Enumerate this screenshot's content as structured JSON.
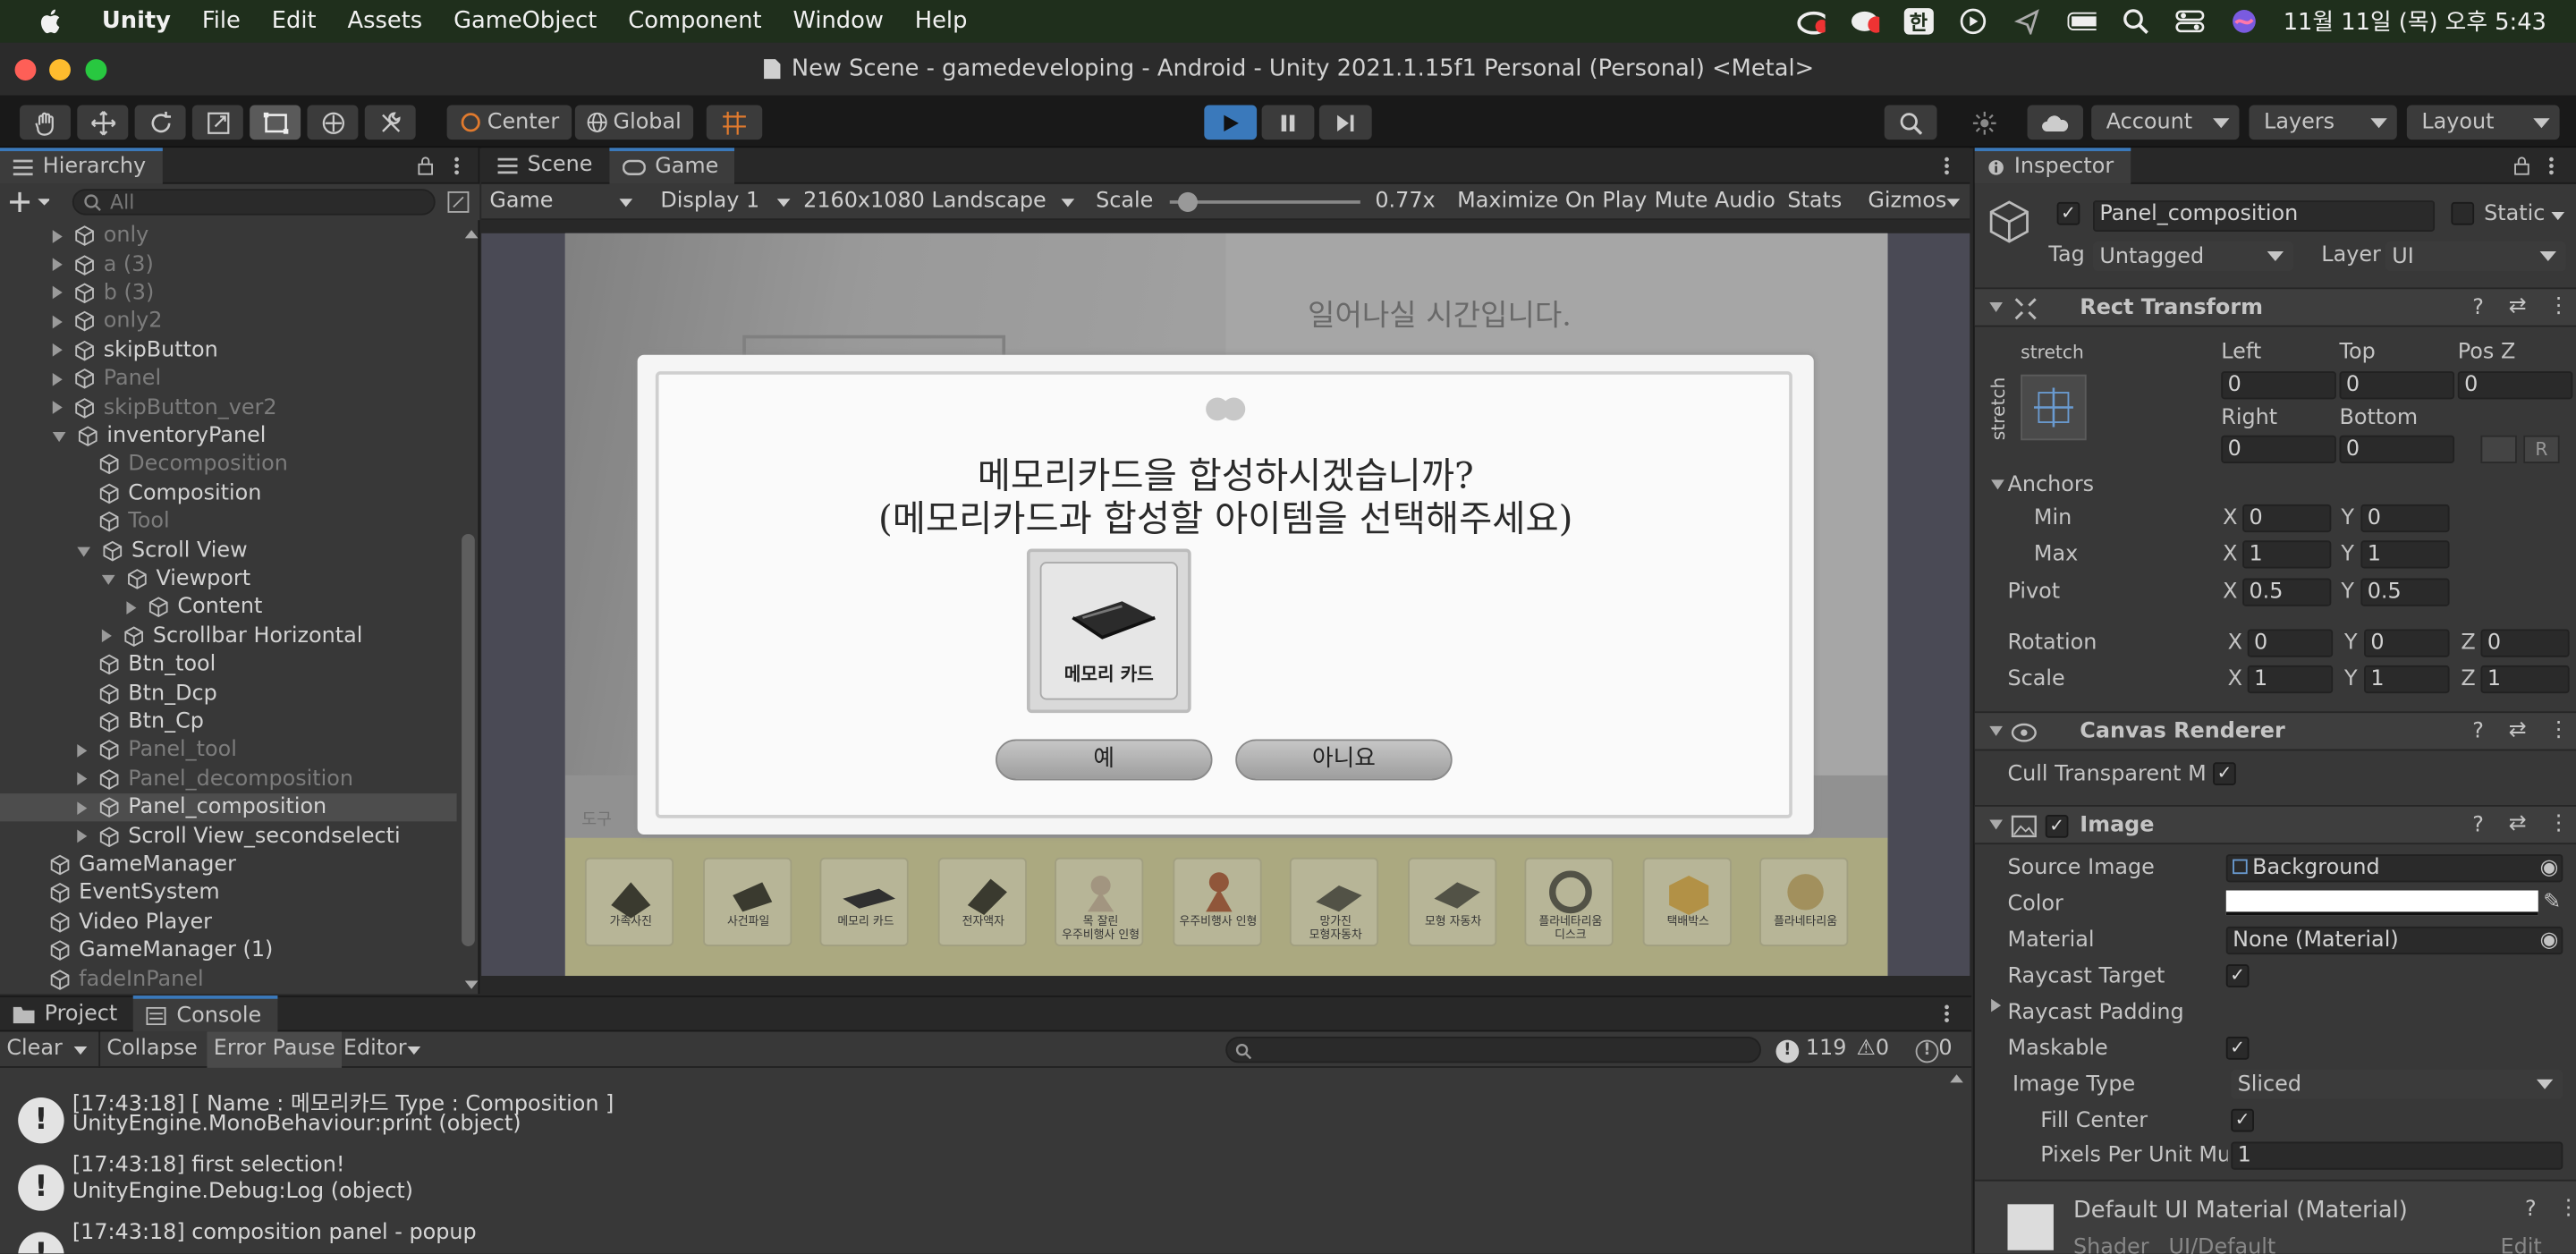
{
  "menubar": {
    "app": "Unity",
    "items": [
      "File",
      "Edit",
      "Assets",
      "GameObject",
      "Component",
      "Window",
      "Help"
    ],
    "clock": "11월 11일 (목) 오후 5:43",
    "ime": "한"
  },
  "window": {
    "title": "New Scene - gamedeveloping - Android - Unity 2021.1.15f1 Personal (Personal) <Metal>"
  },
  "toolbar": {
    "pivot": "Center",
    "space": "Global",
    "account": "Account",
    "layers": "Layers",
    "layout": "Layout"
  },
  "hierarchy": {
    "tab": "Hierarchy",
    "search_placeholder": "All",
    "rows": [
      {
        "label": "only",
        "depth": 2,
        "arrow": "r",
        "dim": true
      },
      {
        "label": "a (3)",
        "depth": 2,
        "arrow": "r",
        "dim": true
      },
      {
        "label": "b (3)",
        "depth": 2,
        "arrow": "r",
        "dim": true
      },
      {
        "label": "only2",
        "depth": 2,
        "arrow": "r",
        "dim": true
      },
      {
        "label": "skipButton",
        "depth": 2,
        "arrow": "r",
        "dim": false
      },
      {
        "label": "Panel",
        "depth": 2,
        "arrow": "r",
        "dim": true
      },
      {
        "label": "skipButton_ver2",
        "depth": 2,
        "arrow": "r",
        "dim": true
      },
      {
        "label": "inventoryPanel",
        "depth": 2,
        "arrow": "d",
        "dim": false
      },
      {
        "label": "Decomposition",
        "depth": 3,
        "arrow": "",
        "dim": true
      },
      {
        "label": "Composition",
        "depth": 3,
        "arrow": "",
        "dim": false
      },
      {
        "label": "Tool",
        "depth": 3,
        "arrow": "",
        "dim": true
      },
      {
        "label": "Scroll View",
        "depth": 3,
        "arrow": "d",
        "dim": false
      },
      {
        "label": "Viewport",
        "depth": 4,
        "arrow": "d",
        "dim": false
      },
      {
        "label": "Content",
        "depth": 5,
        "arrow": "r",
        "dim": false
      },
      {
        "label": "Scrollbar Horizontal",
        "depth": 4,
        "arrow": "r",
        "dim": false
      },
      {
        "label": "Btn_tool",
        "depth": 3,
        "arrow": "",
        "dim": false
      },
      {
        "label": "Btn_Dcp",
        "depth": 3,
        "arrow": "",
        "dim": false
      },
      {
        "label": "Btn_Cp",
        "depth": 3,
        "arrow": "",
        "dim": false
      },
      {
        "label": "Panel_tool",
        "depth": 3,
        "arrow": "r",
        "dim": true
      },
      {
        "label": "Panel_decomposition",
        "depth": 3,
        "arrow": "r",
        "dim": true
      },
      {
        "label": "Panel_composition",
        "depth": 3,
        "arrow": "r",
        "dim": false,
        "selected": true
      },
      {
        "label": "Scroll View_secondselecti",
        "depth": 3,
        "arrow": "r",
        "dim": false
      },
      {
        "label": "GameManager",
        "depth": 1,
        "arrow": "",
        "dim": false
      },
      {
        "label": "EventSystem",
        "depth": 1,
        "arrow": "",
        "dim": false
      },
      {
        "label": "Video Player",
        "depth": 1,
        "arrow": "",
        "dim": false
      },
      {
        "label": "GameManager (1)",
        "depth": 1,
        "arrow": "",
        "dim": false
      },
      {
        "label": "fadeInPanel",
        "depth": 1,
        "arrow": "",
        "dim": true
      }
    ]
  },
  "game": {
    "tabs": {
      "scene": "Scene",
      "game": "Game"
    },
    "display_mode": "Game",
    "display": "Display 1",
    "resolution": "2160x1080 Landscape",
    "scale_label": "Scale",
    "scale_value": "0.77x",
    "scale_fraction": 0.04,
    "maximize": "Maximize On Play",
    "mute": "Mute Audio",
    "stats": "Stats",
    "gizmos": "Gizmos",
    "screen": {
      "bg_text": "일어나실 시간입니다.",
      "tool_label": "도구",
      "dialog_line1": "메모리카드을 합성하시겠습니까?",
      "dialog_line2": "(메모리카드과 합성할 아이템을 선택해주세요)",
      "card_label": "메모리 카드",
      "yes": "예",
      "no": "아니요",
      "items": [
        {
          "label": "가족사진"
        },
        {
          "label": "사건파일"
        },
        {
          "label": "메모리 카드"
        },
        {
          "label": "전자액자"
        },
        {
          "label": "목 잘린\n우주비행사 인형"
        },
        {
          "label": "우주비행사 인형"
        },
        {
          "label": "망가진\n모형자동차"
        },
        {
          "label": "모형 자동차"
        },
        {
          "label": "플라네타리움\n디스크"
        },
        {
          "label": "택배박스"
        },
        {
          "label": "플라네타리움"
        }
      ]
    }
  },
  "inspector": {
    "tab": "Inspector",
    "object_name": "Panel_composition",
    "static": "Static",
    "tag_label": "Tag",
    "tag": "Untagged",
    "layer_label": "Layer",
    "layer": "UI",
    "rect": {
      "title": "Rect Transform",
      "stretch_top": "stretch",
      "stretch_side": "stretch",
      "left_label": "Left",
      "top_label": "Top",
      "posz_label": "Pos Z",
      "left": "0",
      "top": "0",
      "posz": "0",
      "right_label": "Right",
      "bottom_label": "Bottom",
      "right": "0",
      "bottom": "0",
      "r_btn": "R",
      "anchors": "Anchors",
      "min": "Min",
      "max": "Max",
      "min_x": "0",
      "min_y": "0",
      "max_x": "1",
      "max_y": "1",
      "pivot": "Pivot",
      "pivot_x": "0.5",
      "pivot_y": "0.5",
      "rotation": "Rotation",
      "rot_x": "0",
      "rot_y": "0",
      "rot_z": "0",
      "scale": "Scale",
      "sc_x": "1",
      "sc_y": "1",
      "sc_z": "1",
      "x": "X",
      "y": "Y",
      "z": "Z"
    },
    "canvas": {
      "title": "Canvas Renderer",
      "cull": "Cull Transparent Mes"
    },
    "image": {
      "title": "Image",
      "source_label": "Source Image",
      "source": "Background",
      "color_label": "Color",
      "material_label": "Material",
      "material": "None (Material)",
      "raycast": "Raycast Target",
      "raycast_padding": "Raycast Padding",
      "maskable": "Maskable",
      "type_label": "Image Type",
      "type": "Sliced",
      "fill": "Fill Center",
      "ppu_label": "Pixels Per Unit Mul",
      "ppu": "1"
    },
    "material": {
      "title": "Default UI Material (Material)",
      "shader_label": "Shader",
      "shader": "UI/Default",
      "edit": "Edit"
    }
  },
  "console": {
    "tabs": {
      "project": "Project",
      "console": "Console"
    },
    "clear": "Clear",
    "collapse": "Collapse",
    "error_pause": "Error Pause",
    "editor": "Editor",
    "count_log": "119",
    "count_warn": "0",
    "count_err": "0",
    "rows": [
      {
        "line1": "[17:43:18] [ Name : 메모리카드 Type : Composition ]",
        "line2": "UnityEngine.MonoBehaviour:print (object)"
      },
      {
        "line1": "[17:43:18] first selection!",
        "line2": "UnityEngine.Debug:Log (object)"
      },
      {
        "line1": "[17:43:18] composition panel - popup",
        "line2": ""
      }
    ]
  }
}
